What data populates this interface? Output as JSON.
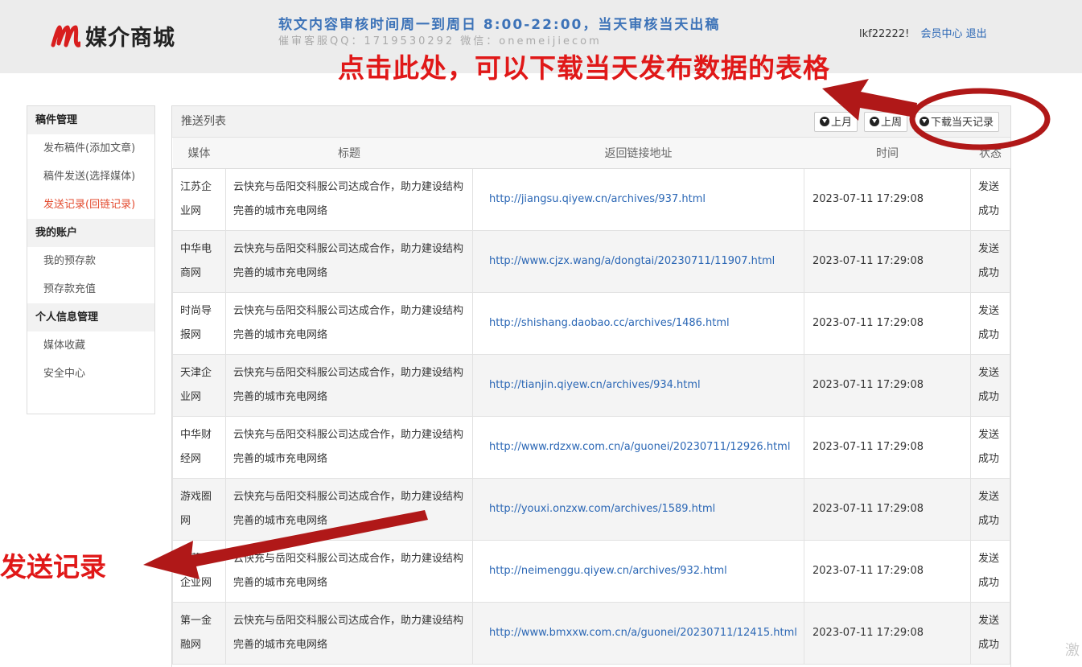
{
  "header": {
    "logo_text": "媒介商城",
    "notice_line1": "软文内容审核时间周一到周日 8:00-22:00，当天审核当天出稿",
    "notice_line2": "催审客服QQ：1719530292 微信：onemeijiecom",
    "username": "lkf22222!",
    "member_center": "会员中心",
    "logout": "退出"
  },
  "annotations": {
    "top": "点击此处，可以下载当天发布数据的表格",
    "left": "发送记录"
  },
  "sidebar": {
    "groups": [
      {
        "title": "稿件管理",
        "items": [
          "发布稿件(添加文章)",
          "稿件发送(选择媒体)",
          "发送记录(回链记录)"
        ]
      },
      {
        "title": "我的账户",
        "items": [
          "我的预存款",
          "预存款充值"
        ]
      },
      {
        "title": "个人信息管理",
        "items": [
          "媒体收藏",
          "安全中心"
        ]
      }
    ],
    "active_item": "发送记录(回链记录)"
  },
  "panel": {
    "title": "推送列表",
    "buttons": {
      "last_month": "上月",
      "last_week": "上周",
      "download_today": "下载当天记录"
    },
    "columns": [
      "媒体",
      "标题",
      "返回链接地址",
      "时间",
      "状态"
    ],
    "rows": [
      {
        "media": "江苏企业网",
        "title": "云快充与岳阳交科服公司达成合作，助力建设结构完善的城市充电网络",
        "link": "http://jiangsu.qiyew.cn/archives/937.html",
        "time": "2023-07-11 17:29:08",
        "status": "发送成功"
      },
      {
        "media": "中华电商网",
        "title": "云快充与岳阳交科服公司达成合作，助力建设结构完善的城市充电网络",
        "link": "http://www.cjzx.wang/a/dongtai/20230711/11907.html",
        "time": "2023-07-11 17:29:08",
        "status": "发送成功"
      },
      {
        "media": "时尚导报网",
        "title": "云快充与岳阳交科服公司达成合作，助力建设结构完善的城市充电网络",
        "link": "http://shishang.daobao.cc/archives/1486.html",
        "time": "2023-07-11 17:29:08",
        "status": "发送成功"
      },
      {
        "media": "天津企业网",
        "title": "云快充与岳阳交科服公司达成合作，助力建设结构完善的城市充电网络",
        "link": "http://tianjin.qiyew.cn/archives/934.html",
        "time": "2023-07-11 17:29:08",
        "status": "发送成功"
      },
      {
        "media": "中华财经网",
        "title": "云快充与岳阳交科服公司达成合作，助力建设结构完善的城市充电网络",
        "link": "http://www.rdzxw.com.cn/a/guonei/20230711/12926.html",
        "time": "2023-07-11 17:29:08",
        "status": "发送成功"
      },
      {
        "media": "游戏圈网",
        "title": "云快充与岳阳交科服公司达成合作，助力建设结构完善的城市充电网络",
        "link": "http://youxi.onzxw.com/archives/1589.html",
        "time": "2023-07-11 17:29:08",
        "status": "发送成功"
      },
      {
        "media": "内蒙古企业网",
        "title": "云快充与岳阳交科服公司达成合作，助力建设结构完善的城市充电网络",
        "link": "http://neimenggu.qiyew.cn/archives/932.html",
        "time": "2023-07-11 17:29:08",
        "status": "发送成功"
      },
      {
        "media": "第一金融网",
        "title": "云快充与岳阳交科服公司达成合作，助力建设结构完善的城市充电网络",
        "link": "http://www.bmxxw.com.cn/a/guonei/20230711/12415.html",
        "time": "2023-07-11 17:29:08",
        "status": "发送成功"
      }
    ]
  },
  "watermark": "激",
  "colors": {
    "accent": "#2b67b5",
    "annotation": "#e01818",
    "active": "#e34b2f",
    "logo_red": "#d81e1e"
  }
}
